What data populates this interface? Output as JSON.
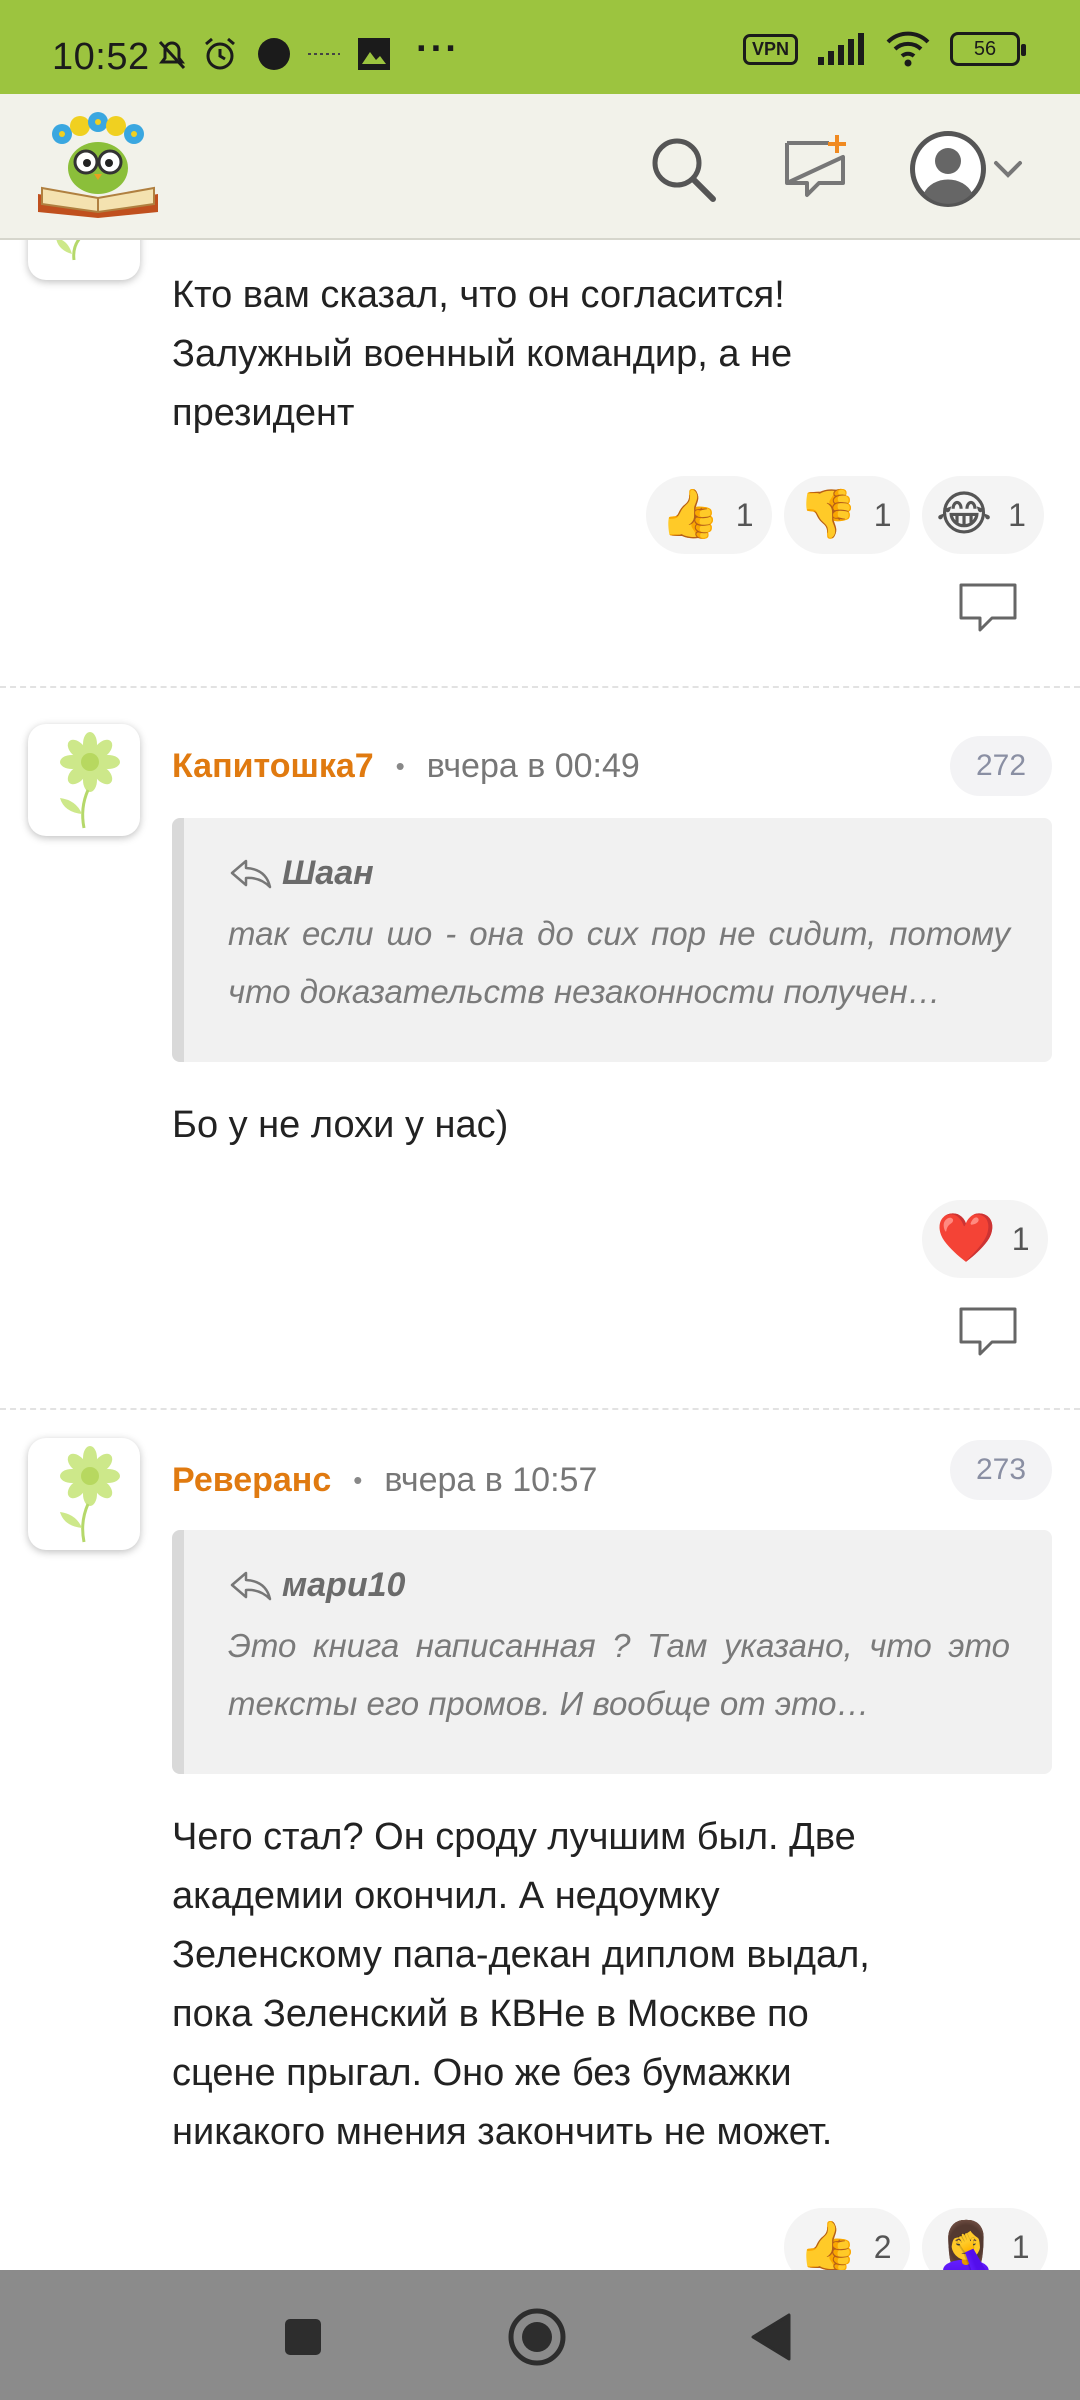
{
  "status_bar": {
    "time": "10:52",
    "vpn": "VPN",
    "battery": "56",
    "bg_color": "#9cc43f"
  },
  "header": {
    "icons": [
      "logo-reading-owl",
      "search-icon",
      "new-post-icon",
      "avatar-icon",
      "chevron-down-icon"
    ]
  },
  "comments": [
    {
      "text_lines": [
        "Кто вам сказал, что он согласится!",
        "Залужный военный командир, а не",
        "президент"
      ],
      "reactions": [
        {
          "emoji": "👍",
          "count": "1"
        },
        {
          "emoji": "👎",
          "count": "1"
        },
        {
          "emoji": "😂",
          "count": "1"
        }
      ]
    },
    {
      "author": "Капитошка7",
      "date": "вчера в 00:49",
      "number": "272",
      "quote": {
        "author": "Шаан",
        "text": "так если шо - она до сих пор не сидит, потому что доказательств незаконности получен…"
      },
      "text_lines": [
        "Бо у не лохи у нас)"
      ],
      "reactions": [
        {
          "emoji": "❤️",
          "count": "1"
        }
      ]
    },
    {
      "author": "Реверанс",
      "date": "вчера в 10:57",
      "number": "273",
      "quote": {
        "author": "мари10",
        "text": "Это книга написанная ? Там указано, что это тексты его промов. И вообще от это…"
      },
      "text_lines": [
        "Чего стал? Он сроду лучшим был. Две",
        "академии окончил. А недоумку",
        "Зеленскому папа-декан диплом выдал,",
        "пока Зеленский в КВНе в Москве по",
        "сцене прыгал. Оно же без бумажки",
        "никакого мнения закончить не может."
      ],
      "reactions": [
        {
          "emoji": "👍",
          "count": "2"
        },
        {
          "emoji": "🤦‍♀️",
          "count": "1"
        }
      ]
    }
  ],
  "colors": {
    "author": "#e07a10",
    "header_bg": "#f2f2ea",
    "navbar_bg": "#8b8b8b"
  }
}
